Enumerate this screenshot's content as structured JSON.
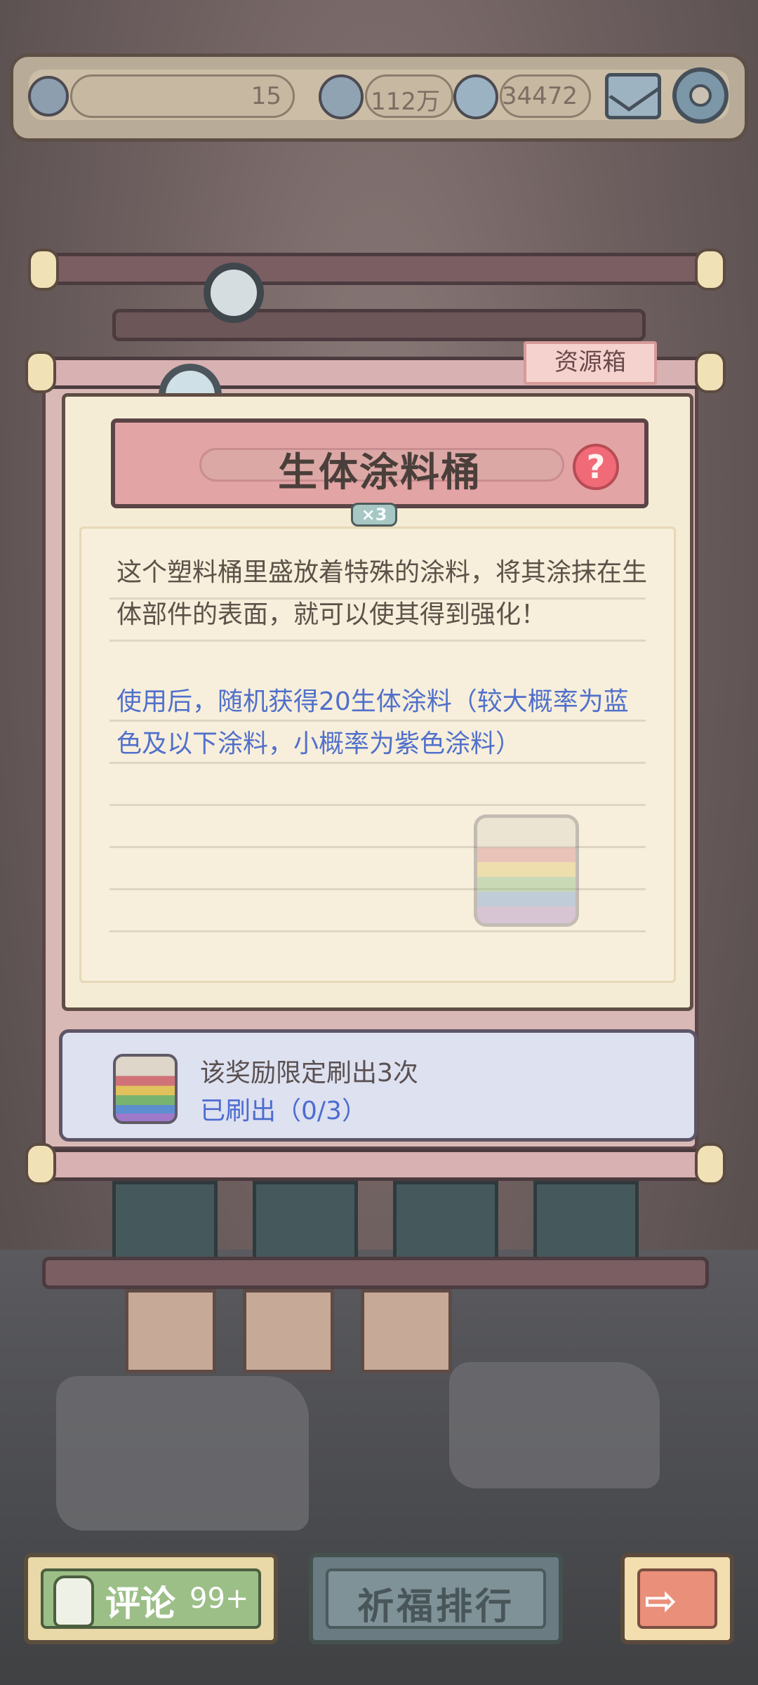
{
  "topbar": {
    "res1_value": "15",
    "res2_value": "112万",
    "res3_value": "34472"
  },
  "icons": {
    "menu": "knot-icon",
    "res2": "spirit-icon",
    "res3": "soul-icon",
    "mail": "mail-icon",
    "settings": "gear-icon"
  },
  "popup": {
    "category_tag": "资源箱",
    "item_name": "生体涂料桶",
    "item_quantity": "×3",
    "help_symbol": "?",
    "description": "这个塑料桶里盛放着特殊的涂料，将其涂抹在生体部件的表面，就可以使其得到强化！",
    "effect": "使用后，随机获得20生体涂料（较大概率为蓝色及以下涂料，小概率为紫色涂料）",
    "limit_text": "该奖励限定刷出3次",
    "refresh_status": "已刷出（0/3）"
  },
  "bottom": {
    "comment_label": "评论",
    "comment_count": "99+",
    "rank_label": "祈福排行",
    "next_symbol": "⇨"
  },
  "colors": {
    "title_bg": "#e3a4a5",
    "effect_text": "#5170cc",
    "paper": "#f5ecd6",
    "comment_button": "#9cbf88"
  }
}
